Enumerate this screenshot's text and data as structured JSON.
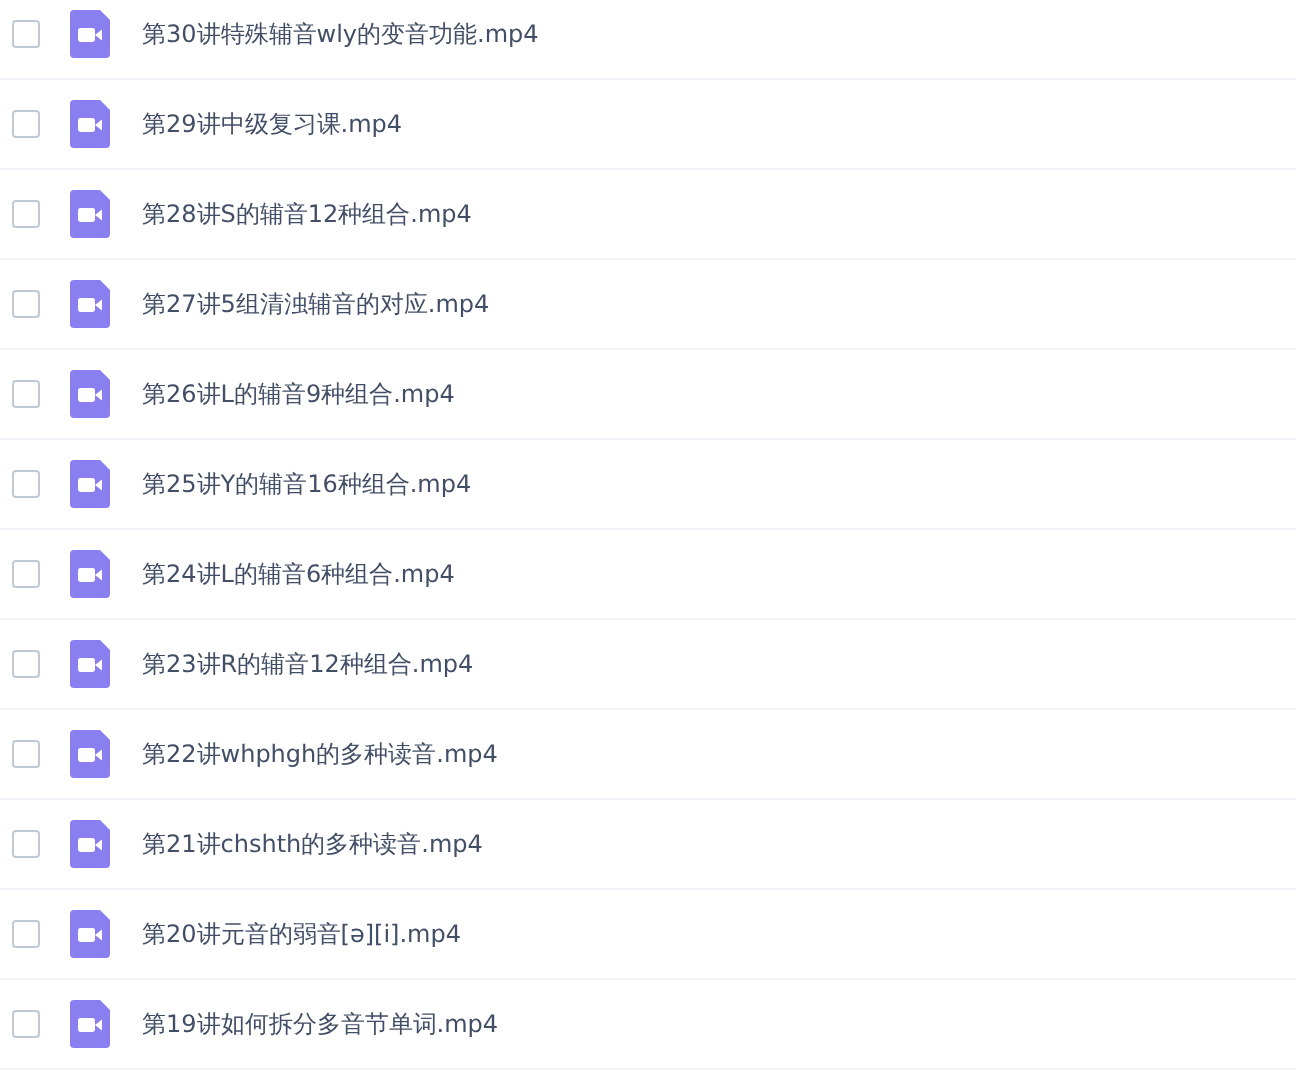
{
  "files": [
    {
      "name": "第30讲特殊辅音wly的变音功能.mp4",
      "checked": false
    },
    {
      "name": "第29讲中级复习课.mp4",
      "checked": false
    },
    {
      "name": "第28讲S的辅音12种组合.mp4",
      "checked": false
    },
    {
      "name": "第27讲5组清浊辅音的对应.mp4",
      "checked": false
    },
    {
      "name": "第26讲L的辅音9种组合.mp4",
      "checked": false
    },
    {
      "name": "第25讲Y的辅音16种组合.mp4",
      "checked": false
    },
    {
      "name": "第24讲L的辅音6种组合.mp4",
      "checked": false
    },
    {
      "name": "第23讲R的辅音12种组合.mp4",
      "checked": false
    },
    {
      "name": "第22讲whphgh的多种读音.mp4",
      "checked": false
    },
    {
      "name": "第21讲chshth的多种读音.mp4",
      "checked": false
    },
    {
      "name": "第20讲元音的弱音[ə][i].mp4",
      "checked": false
    },
    {
      "name": "第19讲如何拆分多音节单词.mp4",
      "checked": false
    }
  ]
}
